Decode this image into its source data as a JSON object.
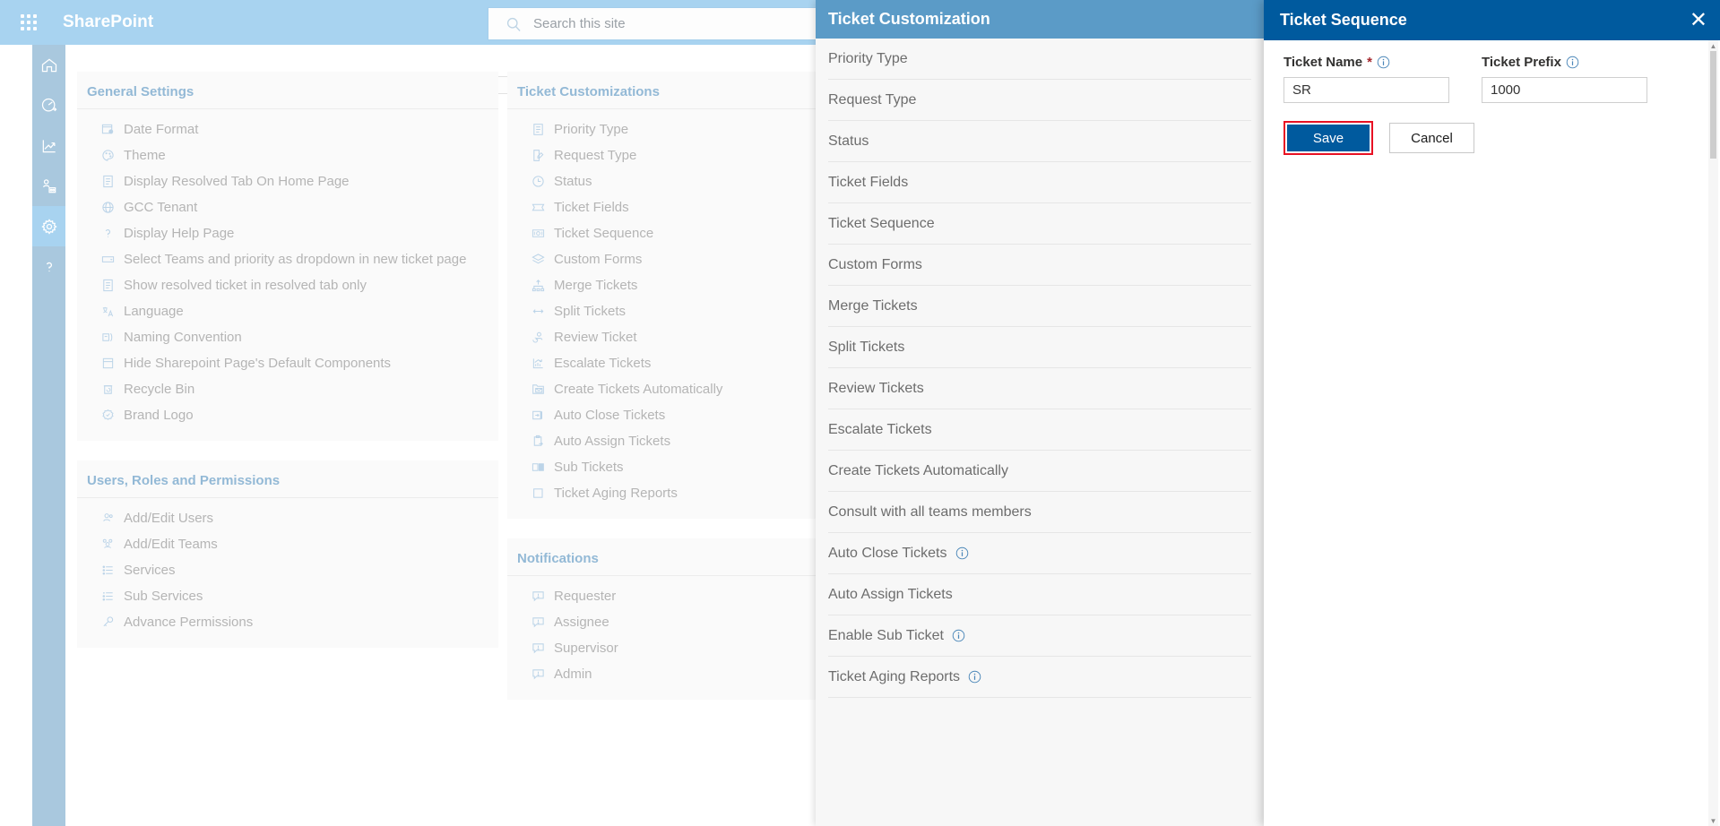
{
  "suite": {
    "waffle_label": "app-launcher",
    "brand": "SharePoint",
    "search_placeholder": "Search this site"
  },
  "rail": {
    "items": [
      {
        "name": "home",
        "icon": "home-icon"
      },
      {
        "name": "dashboard",
        "icon": "gauge-icon"
      },
      {
        "name": "reports",
        "icon": "chart-line-icon"
      },
      {
        "name": "teams",
        "icon": "people-icon"
      },
      {
        "name": "settings",
        "icon": "gear-icon",
        "active": true
      },
      {
        "name": "help",
        "icon": "question-icon"
      }
    ]
  },
  "settings": {
    "sections": [
      {
        "title": "General Settings",
        "items": [
          {
            "label": "Date Format",
            "icon": "calendar-clock-icon"
          },
          {
            "label": "Theme",
            "icon": "palette-icon"
          },
          {
            "label": "Display Resolved Tab On Home Page",
            "icon": "document-icon"
          },
          {
            "label": "GCC Tenant",
            "icon": "globe-icon"
          },
          {
            "label": "Display Help Page",
            "icon": "question-icon"
          },
          {
            "label": "Select Teams and priority as dropdown in new ticket page",
            "icon": "dropdown-icon"
          },
          {
            "label": "Show resolved ticket in resolved tab only",
            "icon": "document-icon"
          },
          {
            "label": "Language",
            "icon": "translate-icon"
          },
          {
            "label": "Naming Convention",
            "icon": "rename-icon"
          },
          {
            "label": "Hide Sharepoint Page's Default Components",
            "icon": "page-icon"
          },
          {
            "label": "Recycle Bin",
            "icon": "recycle-bin-icon"
          },
          {
            "label": "Brand Logo",
            "icon": "badge-icon"
          }
        ]
      },
      {
        "title": "Users, Roles and Permissions",
        "items": [
          {
            "label": "Add/Edit Users",
            "icon": "users-icon"
          },
          {
            "label": "Add/Edit Teams",
            "icon": "team-icon"
          },
          {
            "label": "Services",
            "icon": "list-icon"
          },
          {
            "label": "Sub Services",
            "icon": "sub-list-icon"
          },
          {
            "label": "Advance Permissions",
            "icon": "key-icon"
          }
        ]
      }
    ],
    "sections_right": [
      {
        "title": "Ticket Customizations",
        "items": [
          {
            "label": "Priority Type",
            "icon": "priority-list-icon"
          },
          {
            "label": "Request Type",
            "icon": "edit-page-icon"
          },
          {
            "label": "Status",
            "icon": "clock-icon"
          },
          {
            "label": "Ticket Fields",
            "icon": "ticket-icon"
          },
          {
            "label": "Ticket Sequence",
            "icon": "money-icon"
          },
          {
            "label": "Custom Forms",
            "icon": "layers-icon"
          },
          {
            "label": "Merge Tickets",
            "icon": "merge-icon"
          },
          {
            "label": "Split Tickets",
            "icon": "split-icon"
          },
          {
            "label": "Review Ticket",
            "icon": "review-person-icon"
          },
          {
            "label": "Escalate Tickets",
            "icon": "chart-up-icon"
          },
          {
            "label": "Create Tickets Automatically",
            "icon": "mail-folder-icon"
          },
          {
            "label": "Auto Close Tickets",
            "icon": "exit-icon"
          },
          {
            "label": "Auto Assign Tickets",
            "icon": "clipboard-arrow-icon"
          },
          {
            "label": "Sub Tickets",
            "icon": "columns-icon"
          },
          {
            "label": "Ticket Aging Reports",
            "icon": "square-icon"
          }
        ]
      },
      {
        "title": "Notifications",
        "items": [
          {
            "label": "Requester",
            "icon": "alert-bubble-icon"
          },
          {
            "label": "Assignee",
            "icon": "alert-bubble-icon"
          },
          {
            "label": "Supervisor",
            "icon": "alert-bubble-icon"
          },
          {
            "label": "Admin",
            "icon": "alert-bubble-icon"
          }
        ]
      }
    ]
  },
  "mid_panel": {
    "title": "Ticket Customization",
    "items": [
      {
        "label": "Priority Type",
        "info": false
      },
      {
        "label": "Request Type",
        "info": false
      },
      {
        "label": "Status",
        "info": false
      },
      {
        "label": "Ticket Fields",
        "info": false
      },
      {
        "label": "Ticket Sequence",
        "info": false
      },
      {
        "label": "Custom Forms",
        "info": false
      },
      {
        "label": "Merge Tickets",
        "info": false
      },
      {
        "label": "Split Tickets",
        "info": false
      },
      {
        "label": "Review Tickets",
        "info": false
      },
      {
        "label": "Escalate Tickets",
        "info": false
      },
      {
        "label": "Create Tickets Automatically",
        "info": false
      },
      {
        "label": "Consult with all teams members",
        "info": false
      },
      {
        "label": "Auto Close Tickets",
        "info": true
      },
      {
        "label": "Auto Assign Tickets",
        "info": false
      },
      {
        "label": "Enable Sub Ticket",
        "info": true
      },
      {
        "label": "Ticket Aging Reports",
        "info": true
      }
    ]
  },
  "modal": {
    "title": "Ticket Sequence",
    "close_label": "✕",
    "ticket_name_label": "Ticket Name",
    "ticket_name_required": "*",
    "ticket_name_value": "SR",
    "ticket_prefix_label": "Ticket Prefix",
    "ticket_prefix_value": "1000",
    "save_label": "Save",
    "cancel_label": "Cancel",
    "highlight_color": "#e81123",
    "header_color": "#005a9e"
  }
}
